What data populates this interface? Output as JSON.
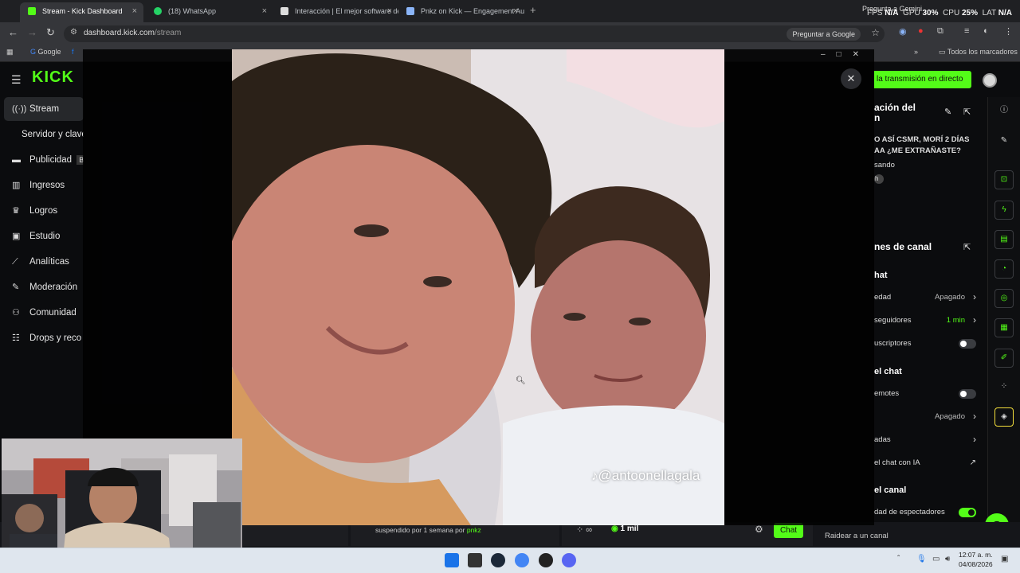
{
  "browser": {
    "tabs": [
      {
        "label": "Stream - Kick Dashboard",
        "active": true
      },
      {
        "label": "(18) WhatsApp"
      },
      {
        "label": "Interacción | El mejor software de"
      },
      {
        "label": "Pnkz on Kick — Engagement Au"
      }
    ],
    "sysstats": {
      "fps_label": "FPS",
      "fps_value": "N/A",
      "gpu_label": "GPU",
      "gpu_value": "30%",
      "cpu_label": "CPU",
      "cpu_value": "25%",
      "lat_label": "LAT",
      "lat_value": "N/A"
    },
    "gemini": "Pregunta a Gemini",
    "url_host": "dashboard.kick.com",
    "url_path": "/stream",
    "ask_google": "Preguntar a Google",
    "bookmarks": {
      "google": "Google",
      "all": "Todos los marcadores"
    }
  },
  "kick": {
    "logo": "KICK",
    "sidebar": [
      {
        "label": "Stream",
        "icon": "broadcast-icon",
        "active": true
      },
      {
        "label": "Servidor y clave",
        "sub": true
      },
      {
        "label": "Publicidad",
        "icon": "ad-icon",
        "badge": "B"
      },
      {
        "label": "Ingresos",
        "icon": "revenue-icon"
      },
      {
        "label": "Logros",
        "icon": "trophy-icon"
      },
      {
        "label": "Estudio",
        "icon": "studio-icon"
      },
      {
        "label": "Analíticas",
        "icon": "analytics-icon"
      },
      {
        "label": "Moderación",
        "icon": "wrench-icon"
      },
      {
        "label": "Comunidad",
        "icon": "community-icon"
      },
      {
        "label": "Drops y reco",
        "icon": "drops-icon"
      }
    ],
    "go_live": "la transmisión en directo",
    "stream_info": {
      "title": "ación del",
      "title2": "n",
      "stream_title_1": "O ASÍ CSMR, MORÍ 2 DÍAS",
      "stream_title_2": "AA ¿ME EXTRAÑASTE?",
      "category": "sando",
      "tag": "h"
    },
    "channel_options": {
      "title": "nes de canal",
      "chat_section": "hat",
      "rows": [
        {
          "label": "edad",
          "value": "Apagado",
          "type": "chevron"
        },
        {
          "label": "seguidores",
          "value": "1 min",
          "type": "chevron",
          "green": true
        },
        {
          "label": "uscriptores",
          "type": "toggle",
          "on": false
        }
      ],
      "chat2_section": "el chat",
      "rows2": [
        {
          "label": "emotes",
          "type": "toggle",
          "on": false
        },
        {
          "label": "",
          "value": "Apagado",
          "type": "chevron"
        },
        {
          "label": "adas",
          "type": "chevron"
        },
        {
          "label": "el chat con IA",
          "type": "external"
        }
      ],
      "canal_section": "el canal",
      "rows3": [
        {
          "label": "dad de espectadores",
          "type": "toggle",
          "on": true
        }
      ],
      "raid": "Raidear a un canal"
    },
    "bottom": {
      "suspended": "suspendido por 1 semana por",
      "suspended_by": "pnkz",
      "viewers": "1 mil",
      "chat_btn": "Chat"
    }
  },
  "viewer": {
    "watermark": "♪@antoonellagala"
  },
  "taskbar": {
    "time": "12:07 a. m.",
    "date": "04/08/2026"
  },
  "colors": {
    "kick_green": "#53fc18",
    "bg": "#0b0c0e"
  }
}
